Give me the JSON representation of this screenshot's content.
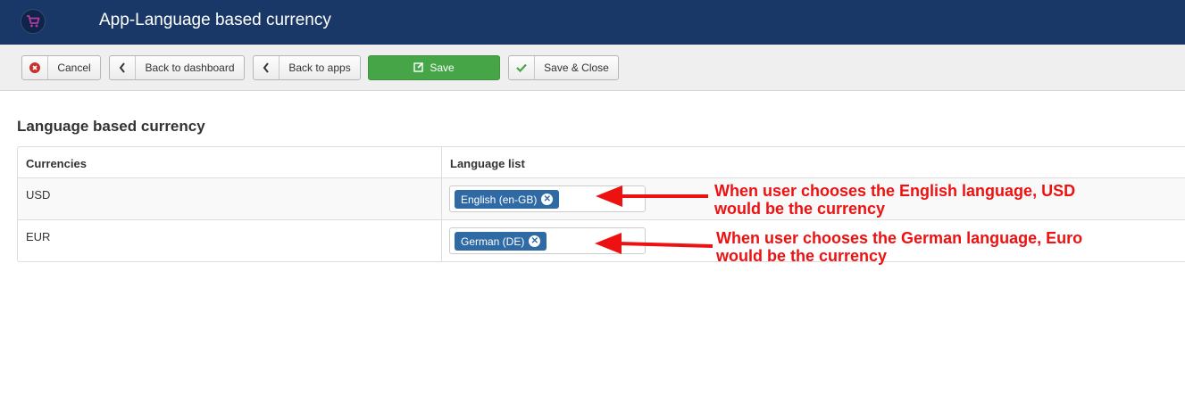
{
  "header": {
    "title": "App-Language based currency"
  },
  "toolbar": {
    "cancel": "Cancel",
    "back_dashboard": "Back to dashboard",
    "back_apps": "Back to apps",
    "save": "Save",
    "save_close": "Save & Close"
  },
  "main": {
    "section_title": "Language based currency",
    "table": {
      "headers": [
        "Currencies",
        "Language list"
      ],
      "rows": [
        {
          "currency": "USD",
          "language": "English (en-GB)"
        },
        {
          "currency": "EUR",
          "language": "German (DE)"
        }
      ]
    }
  },
  "annotations": [
    {
      "line1": "When user chooses the English language, USD",
      "line2": "would be the currency"
    },
    {
      "line1": "When user chooses the German language, Euro",
      "line2": "would be the currency"
    }
  ],
  "colors": {
    "header_bg": "#1a3867",
    "save_bg": "#46a546",
    "tag_bg": "#2f6aa5",
    "annotation": "#ee1111"
  }
}
